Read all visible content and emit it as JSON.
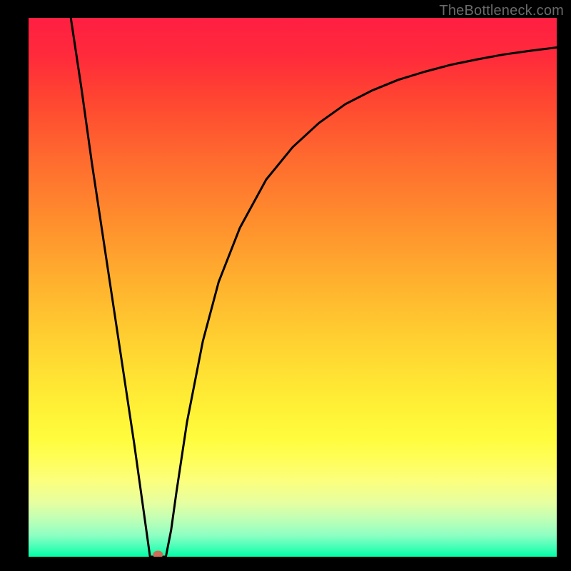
{
  "watermark": "TheBottleneck.com",
  "chart_data": {
    "type": "line",
    "title": "",
    "xlabel": "",
    "ylabel": "",
    "xlim": [
      0,
      100
    ],
    "ylim": [
      0,
      100
    ],
    "curve": {
      "name": "bottleneck-curve",
      "color": "#000000",
      "x": [
        8,
        10,
        12,
        14,
        16,
        18,
        20,
        21,
        22,
        23,
        24,
        25,
        26,
        27,
        28,
        30,
        33,
        36,
        40,
        45,
        50,
        55,
        60,
        65,
        70,
        75,
        80,
        85,
        90,
        95,
        100
      ],
      "y": [
        100,
        87,
        73,
        60,
        47,
        34,
        21,
        14,
        7,
        0,
        0,
        0,
        0,
        5,
        12,
        25,
        40,
        51,
        61,
        70,
        76,
        80.5,
        84,
        86.5,
        88.5,
        90,
        91.3,
        92.3,
        93.2,
        93.9,
        94.5
      ]
    },
    "marker": {
      "name": "optimum-point",
      "x": 24.5,
      "y": 0,
      "color": "#cd6d58",
      "radius_px": 7
    }
  }
}
